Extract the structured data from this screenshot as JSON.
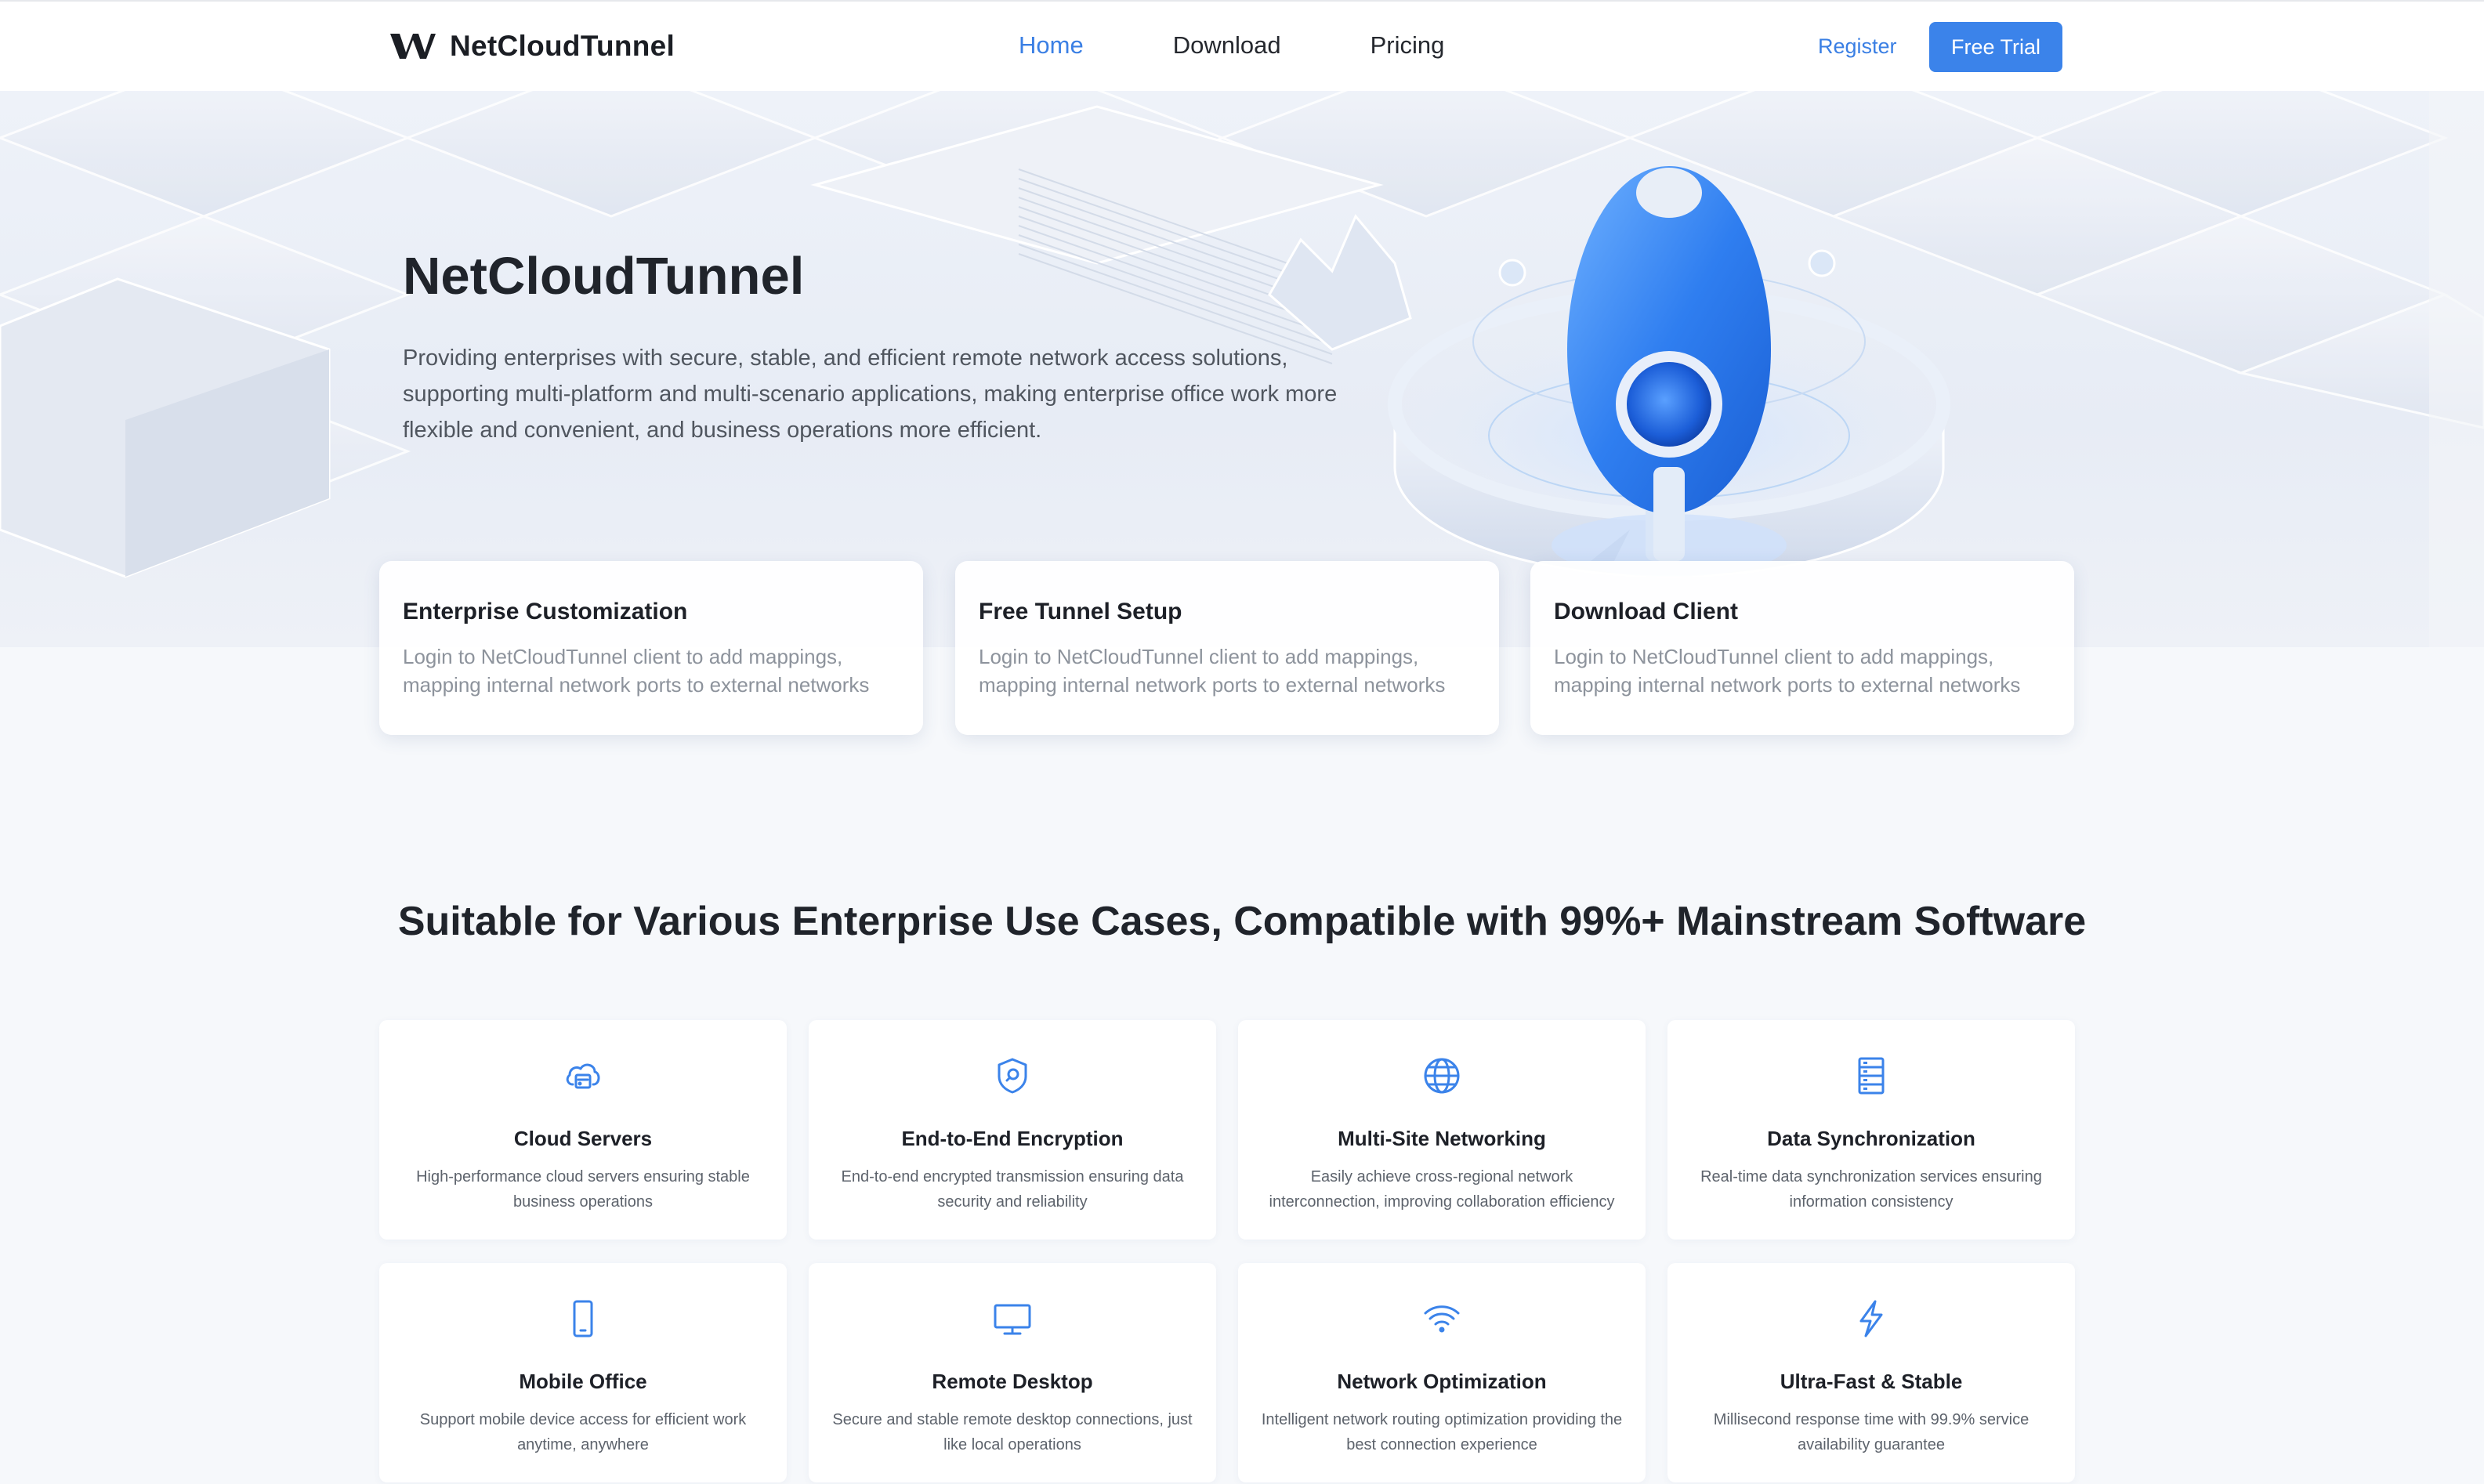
{
  "header": {
    "logo_text": "NetCloudTunnel",
    "nav": [
      "Home",
      "Download",
      "Pricing"
    ],
    "active_nav": "Home",
    "register_label": "Register",
    "trial_label": "Free Trial"
  },
  "hero": {
    "title": "NetCloudTunnel",
    "description": "Providing enterprises with secure, stable, and efficient remote network access solutions, supporting multi-platform and multi-scenario applications, making enterprise office work more flexible and convenient, and business operations more efficient."
  },
  "feature_cards": [
    {
      "title": "Enterprise Customization",
      "desc": "Login to NetCloudTunnel client to add mappings, mapping internal network ports to external networks"
    },
    {
      "title": "Free Tunnel Setup",
      "desc": "Login to NetCloudTunnel client to add mappings, mapping internal network ports to external networks"
    },
    {
      "title": "Download Client",
      "desc": "Login to NetCloudTunnel client to add mappings, mapping internal network ports to external networks"
    }
  ],
  "section": {
    "title": "Suitable for Various Enterprise Use Cases, Compatible with 99%+ Mainstream Software"
  },
  "use_cases": [
    {
      "title": "Cloud Servers",
      "desc": "High-performance cloud servers ensuring stable business operations",
      "icon": "cloud-server-icon"
    },
    {
      "title": "End-to-End Encryption",
      "desc": "End-to-end encrypted transmission ensuring data security and reliability",
      "icon": "shield-icon"
    },
    {
      "title": "Multi-Site Networking",
      "desc": "Easily achieve cross-regional network interconnection, improving collaboration efficiency",
      "icon": "globe-icon"
    },
    {
      "title": "Data Synchronization",
      "desc": "Real-time data synchronization services ensuring information consistency",
      "icon": "server-rack-icon"
    },
    {
      "title": "Mobile Office",
      "desc": "Support mobile device access for efficient work anytime, anywhere",
      "icon": "mobile-icon"
    },
    {
      "title": "Remote Desktop",
      "desc": "Secure and stable remote desktop connections, just like local operations",
      "icon": "monitor-icon"
    },
    {
      "title": "Network Optimization",
      "desc": "Intelligent network routing optimization providing the best connection experience",
      "icon": "wifi-icon"
    },
    {
      "title": "Ultra-Fast & Stable",
      "desc": "Millisecond response time with 99.9% service availability guarantee",
      "icon": "lightning-icon"
    }
  ],
  "colors": {
    "accent": "#3b83ea",
    "nav_active": "#3a7fe4",
    "page_bg": "#f6f8fb"
  }
}
